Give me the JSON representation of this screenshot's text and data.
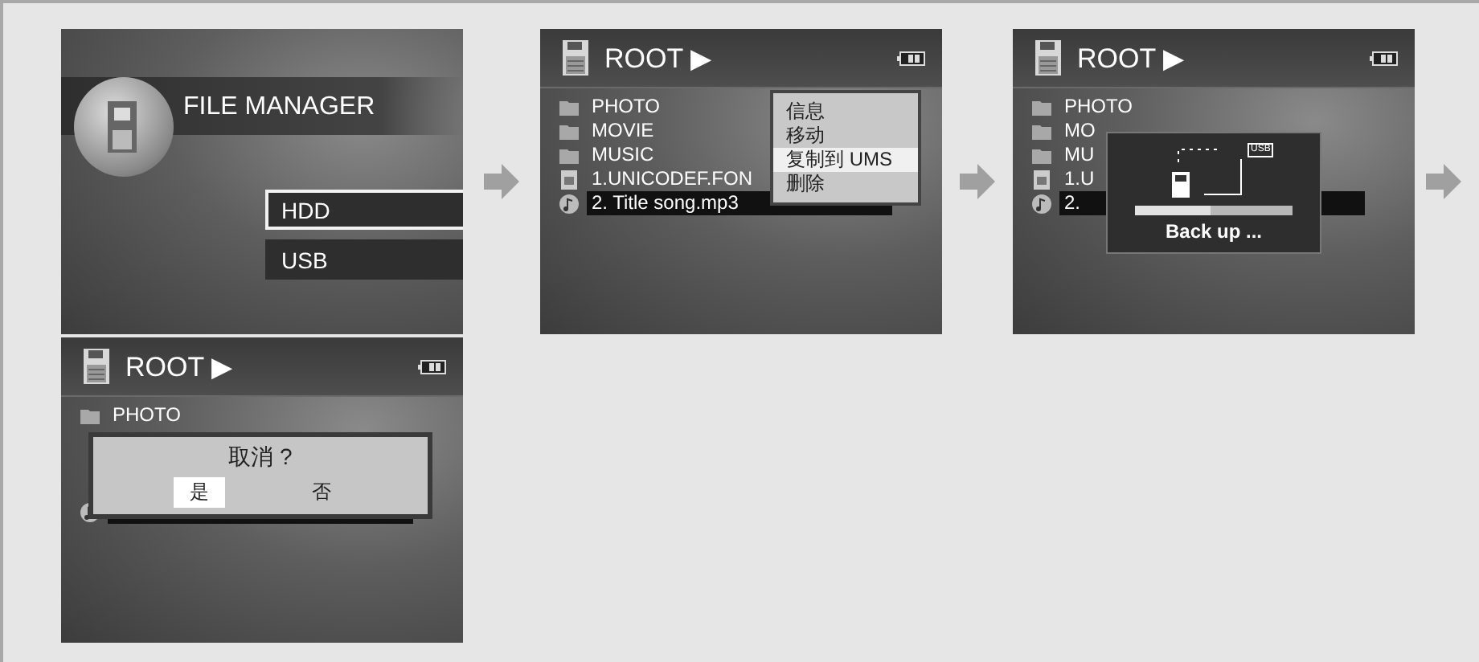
{
  "screens": [
    {
      "kind": "home",
      "title": "FILE MANAGER",
      "options": [
        {
          "label": "HDD",
          "selected": true
        },
        {
          "label": "USB",
          "selected": false
        }
      ]
    },
    {
      "kind": "browser",
      "path": "ROOT ▶",
      "files": [
        {
          "name": "PHOTO",
          "kind": "folder",
          "selected": false
        },
        {
          "name": "MOVIE",
          "kind": "folder",
          "selected": false
        },
        {
          "name": "MUSIC",
          "kind": "folder",
          "selected": false
        },
        {
          "name": "1.UNICODEF.FON",
          "kind": "font",
          "selected": false
        },
        {
          "name": "2. Title song.mp3",
          "kind": "music",
          "selected": true
        }
      ],
      "menu": [
        {
          "label": "信息",
          "selected": false
        },
        {
          "label": "移动",
          "selected": false
        },
        {
          "label": "复制到 UMS",
          "selected": true
        },
        {
          "label": "删除",
          "selected": false
        }
      ]
    },
    {
      "kind": "browser",
      "path": "ROOT ▶",
      "files": [
        {
          "name": "PHOTO",
          "kind": "folder",
          "selected": false
        },
        {
          "name": "MO",
          "kind": "folder",
          "selected": false
        },
        {
          "name": "MU",
          "kind": "folder",
          "selected": false
        },
        {
          "name": "1.U",
          "kind": "font",
          "selected": false
        },
        {
          "name": "2.",
          "kind": "music",
          "selected": true
        }
      ],
      "progress": {
        "badge": "USB",
        "level": 0.48,
        "label": "Back up ..."
      }
    },
    {
      "kind": "browser",
      "path": "ROOT ▶",
      "files": [
        {
          "name": "PHOTO",
          "kind": "folder",
          "selected": false
        },
        {
          "kind": "covered"
        },
        {
          "kind": "covered"
        },
        {
          "kind": "covered"
        },
        {
          "kind": "music",
          "selected": true
        }
      ],
      "confirm": {
        "question": "取消 ?",
        "options": [
          {
            "label": "是",
            "selected": true
          },
          {
            "label": "否",
            "selected": false
          }
        ]
      }
    }
  ]
}
